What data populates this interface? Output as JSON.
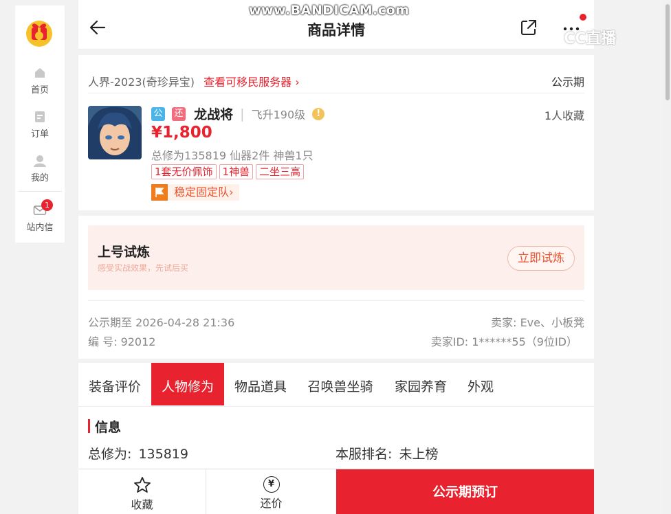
{
  "watermark": "www.BANDICAM.com",
  "watermark2": "CC直播",
  "sidebar": {
    "items": [
      {
        "label": "首页",
        "icon": "home-icon"
      },
      {
        "label": "订单",
        "icon": "order-icon"
      },
      {
        "label": "我的",
        "icon": "user-icon"
      },
      {
        "label": "站内信",
        "icon": "mail-icon",
        "badge": "1"
      }
    ]
  },
  "header": {
    "title": "商品详情"
  },
  "product": {
    "server": "人界-2023(奇珍异宝)",
    "server_link": "查看可移民服务器",
    "status": "公示期",
    "tag_public": "公",
    "tag_bargain": "还",
    "name": "龙战将",
    "level": "飞升190级",
    "favorites": "1人收藏",
    "price": "¥1,800",
    "stats": "总修为135819  仙器2件  神兽1只",
    "pills": [
      "1套无价佩饰",
      "1神兽",
      "二坐三高"
    ],
    "team": "稳定固定队"
  },
  "trial": {
    "title": "上号试炼",
    "subtitle": "感受实战效果，先试后买",
    "button": "立即试炼"
  },
  "meta": {
    "public_until": "公示期至 2026-04-28 21:36",
    "seller": "卖家: Eve、小板凳",
    "number": "编 号: 92012",
    "seller_id": "卖家ID: 1******55（9位ID）"
  },
  "tabs": [
    "装备评价",
    "人物修为",
    "物品道具",
    "召唤兽坐骑",
    "家园养育",
    "外观"
  ],
  "active_tab": 1,
  "info": {
    "section_title": "信息",
    "cultivation_label": "总修为:",
    "cultivation_value": "135819",
    "rank_label": "本服排名:",
    "rank_value": "未上榜"
  },
  "bottom": {
    "favorite": "收藏",
    "bargain": "还价",
    "bargain_icon_text": "¥",
    "buy": "公示期预订"
  },
  "colors": {
    "accent": "#e8232f",
    "bg": "#f2f2f2",
    "trial_bg": "#fdf0ec"
  }
}
